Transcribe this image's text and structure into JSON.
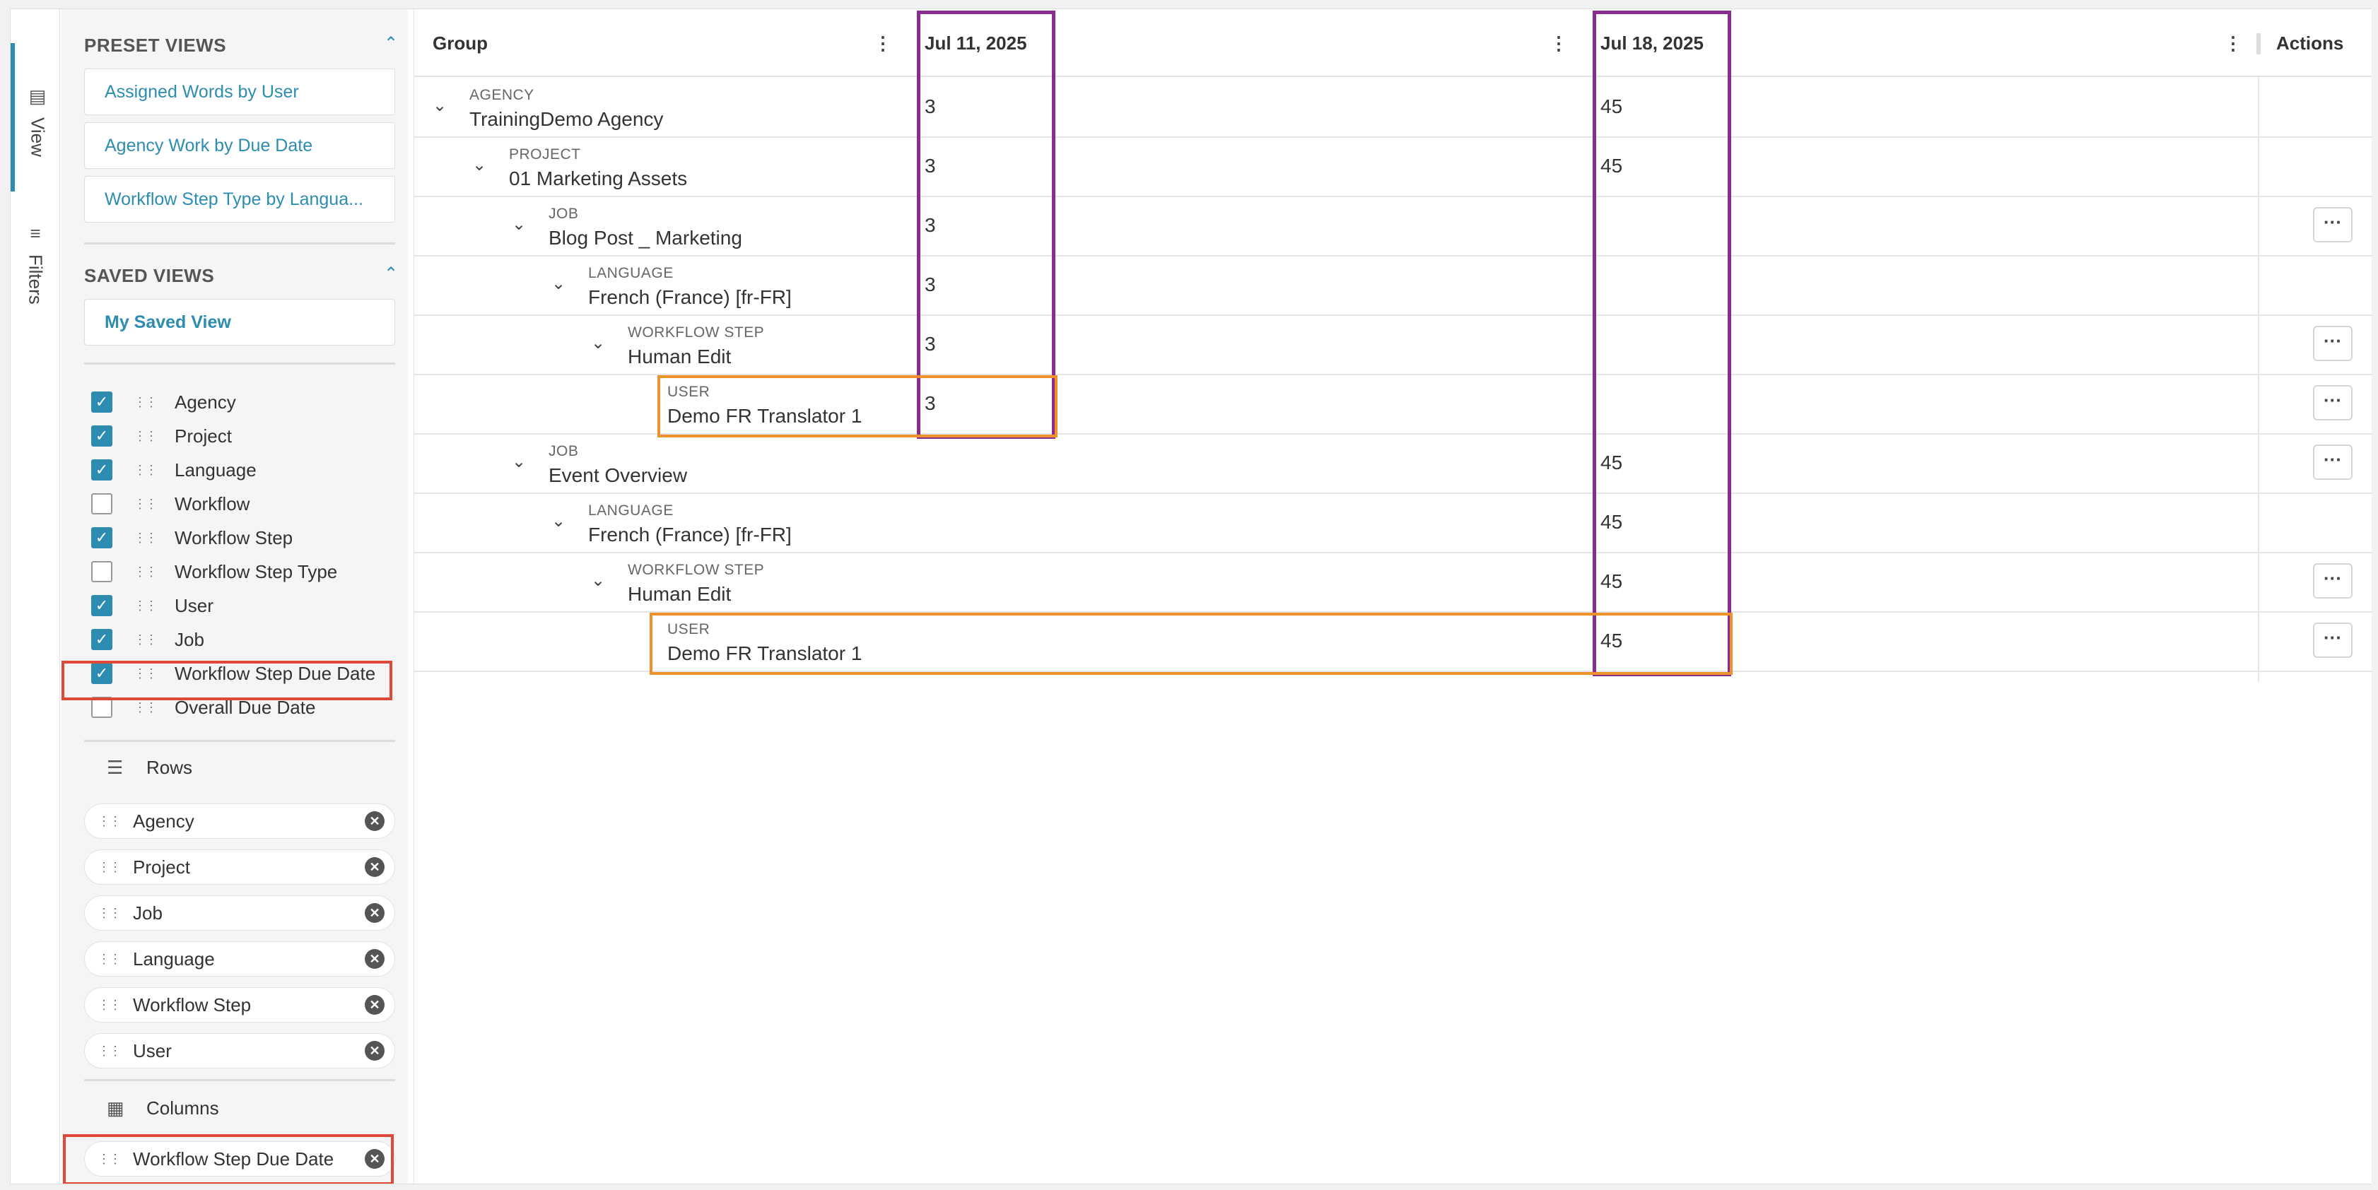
{
  "rail": {
    "view_label": "View",
    "filters_label": "Filters"
  },
  "preset_views": {
    "title": "PRESET VIEWS",
    "items": [
      "Assigned Words by User",
      "Agency Work by Due Date",
      "Workflow Step Type by Langua..."
    ]
  },
  "saved_views": {
    "title": "SAVED VIEWS",
    "items": [
      "My Saved View"
    ]
  },
  "fields": [
    {
      "label": "Agency",
      "checked": true
    },
    {
      "label": "Project",
      "checked": true
    },
    {
      "label": "Language",
      "checked": true
    },
    {
      "label": "Workflow",
      "checked": false
    },
    {
      "label": "Workflow Step",
      "checked": true
    },
    {
      "label": "Workflow Step Type",
      "checked": false
    },
    {
      "label": "User",
      "checked": true
    },
    {
      "label": "Job",
      "checked": true
    },
    {
      "label": "Workflow Step Due Date",
      "checked": true
    },
    {
      "label": "Overall Due Date",
      "checked": false
    }
  ],
  "rows_section": {
    "title": "Rows",
    "items": [
      "Agency",
      "Project",
      "Job",
      "Language",
      "Workflow Step",
      "User"
    ]
  },
  "columns_section": {
    "title": "Columns",
    "items": [
      "Workflow Step Due Date"
    ]
  },
  "grid": {
    "headers": {
      "group": "Group",
      "col1": "Jul 11, 2025",
      "col2": "Jul 18, 2025",
      "actions": "Actions"
    },
    "rows": [
      {
        "type": "AGENCY",
        "name": "TrainingDemo Agency",
        "v1": "3",
        "v2": "45",
        "action": false
      },
      {
        "type": "PROJECT",
        "name": "01 Marketing Assets",
        "v1": "3",
        "v2": "45",
        "action": false
      },
      {
        "type": "JOB",
        "name": "Blog Post _ Marketing",
        "v1": "3",
        "v2": "",
        "action": true
      },
      {
        "type": "LANGUAGE",
        "name": "French (France) [fr-FR]",
        "v1": "3",
        "v2": "",
        "action": false
      },
      {
        "type": "WORKFLOW STEP",
        "name": "Human Edit",
        "v1": "3",
        "v2": "",
        "action": true
      },
      {
        "type": "USER",
        "name": "Demo FR Translator 1",
        "v1": "3",
        "v2": "",
        "action": true
      },
      {
        "type": "JOB",
        "name": "Event Overview",
        "v1": "",
        "v2": "45",
        "action": true
      },
      {
        "type": "LANGUAGE",
        "name": "French (France) [fr-FR]",
        "v1": "",
        "v2": "45",
        "action": false
      },
      {
        "type": "WORKFLOW STEP",
        "name": "Human Edit",
        "v1": "",
        "v2": "45",
        "action": true
      },
      {
        "type": "USER",
        "name": "Demo FR Translator 1",
        "v1": "",
        "v2": "45",
        "action": true
      }
    ]
  },
  "colors": {
    "accent": "#2c8db0",
    "highlight_purple": "#8a2b8f",
    "highlight_orange": "#f0922b",
    "highlight_red": "#e0483a"
  }
}
